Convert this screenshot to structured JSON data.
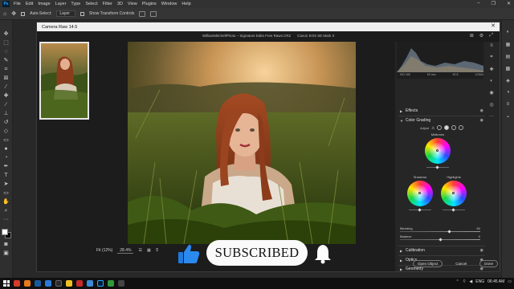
{
  "menubar": {
    "app": "Ps",
    "items": [
      "File",
      "Edit",
      "Image",
      "Layer",
      "Type",
      "Select",
      "Filter",
      "3D",
      "View",
      "Plugins",
      "Window",
      "Help"
    ]
  },
  "options": {
    "auto_select": "Auto-Select:",
    "layer_dropdown": "Layer",
    "show_transform": "Show Transform Controls"
  },
  "acr": {
    "title": "Camera Raw 14.5",
    "file_info": "WilliamMitchellPhoto – Signature Edits Free Raws.CR2",
    "camera": "Canon EOS 6D Mark II",
    "histogram": {
      "iso": "ISO 160",
      "focal": "50 mm",
      "aperture": "f/2.8",
      "shutter": "1/250s"
    },
    "sections": {
      "effects": "Effects",
      "color_grading": "Color Grading",
      "adjust": "Adjust",
      "midtones": "Midtones",
      "shadows": "Shadows",
      "highlights": "Highlights",
      "blending": "Blending",
      "blending_value": "62",
      "balance": "Balance",
      "balance_value": "0",
      "calibration": "Calibration",
      "optics": "Optics",
      "geometry": "Geometry"
    },
    "footer": {
      "fit": "Fit (12%)",
      "zoom": "28.4%"
    },
    "buttons": {
      "open": "Open Object",
      "cancel": "Cancel",
      "done": "Done"
    }
  },
  "overlay": {
    "subscribed": "SUBSCRIBED"
  },
  "taskbar": {
    "lang": "ENG",
    "time": "06:45 AM"
  },
  "colors": {
    "accent": "#31a8ff",
    "panel": "#262626",
    "titlebar": "#f0f0f0"
  }
}
